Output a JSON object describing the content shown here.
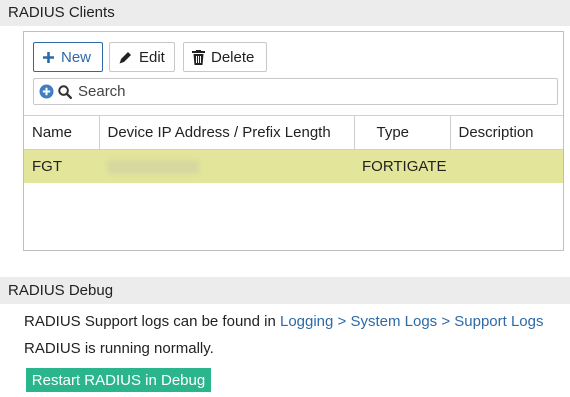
{
  "sections": {
    "clients_title": "RADIUS Clients",
    "debug_title": "RADIUS Debug"
  },
  "toolbar": {
    "new_label": "New",
    "edit_label": "Edit",
    "delete_label": "Delete",
    "new_icon": "plus-icon",
    "edit_icon": "pencil-icon",
    "delete_icon": "trash-icon"
  },
  "search": {
    "placeholder": "Search",
    "value": ""
  },
  "table": {
    "columns": [
      "Name",
      "Device IP Address / Prefix Length",
      "Type",
      "Description"
    ],
    "rows": [
      {
        "name": "FGT",
        "ip": "",
        "type": "FORTIGATE",
        "description": ""
      }
    ]
  },
  "debug": {
    "line1_prefix": "RADIUS Support logs can be found in ",
    "line1_link": "Logging > System Logs > Support Logs",
    "line2": "RADIUS is running normally.",
    "restart_label": "Restart RADIUS in Debug"
  },
  "colors": {
    "accent": "#2d6aa7",
    "selected_row": "#e3e59a",
    "restart_button": "#2ab58c"
  }
}
